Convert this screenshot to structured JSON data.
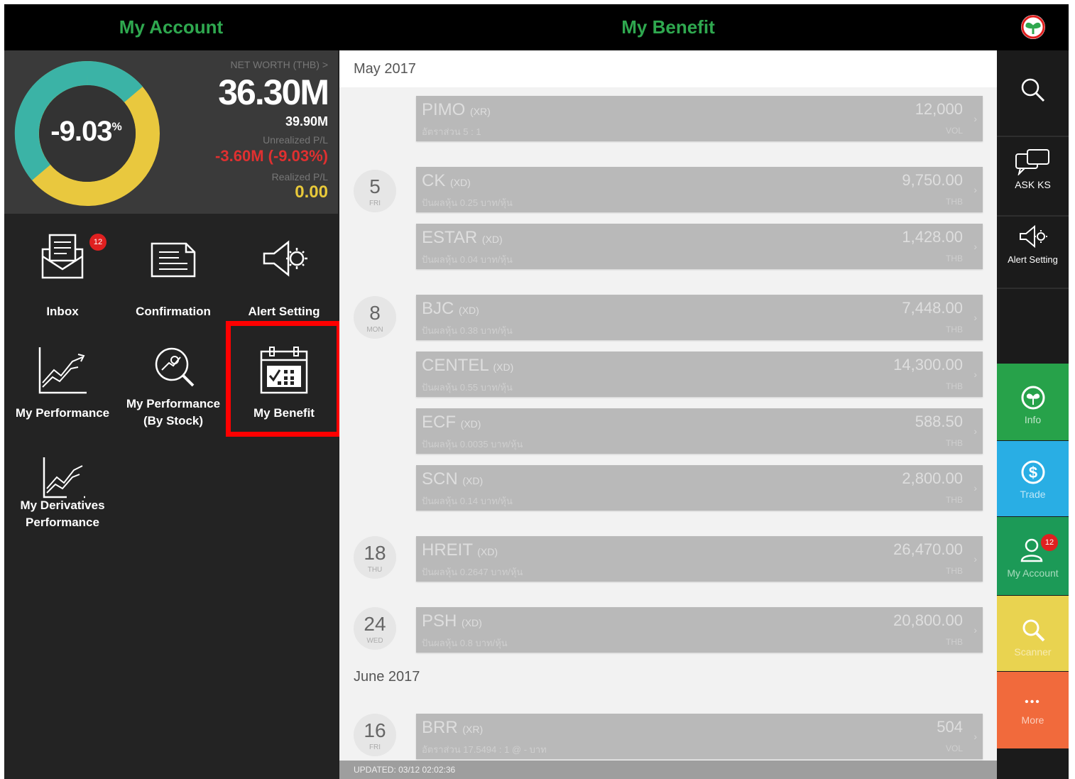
{
  "header": {
    "left_title": "My Account",
    "center_title": "My Benefit"
  },
  "summary": {
    "percent": "-9.03",
    "percent_unit": "%",
    "net_worth_label": "NET WORTH (THB) >",
    "net_worth_value": "36.30M",
    "cost_value": "39.90M",
    "unrealized_label": "Unrealized P/L",
    "unrealized_value": "-3.60M (-9.03%)",
    "realized_label": "Realized P/L",
    "realized_value": "0.00",
    "colors": {
      "teal": "#3bb3a6",
      "yellow": "#e9c83e",
      "loss": "#e03030"
    }
  },
  "menu": {
    "inbox": {
      "label": "Inbox",
      "badge": "12"
    },
    "confirmation": {
      "label": "Confirmation"
    },
    "alert_setting": {
      "label": "Alert Setting"
    },
    "my_performance": {
      "label": "My Performance"
    },
    "my_performance_stock": {
      "label1": "My Performance",
      "label2": "(By Stock)"
    },
    "my_benefit": {
      "label": "My Benefit"
    },
    "my_derivatives": {
      "label1": "My Derivatives",
      "label2": "Performance"
    }
  },
  "benefits": {
    "months": [
      {
        "label": "May 2017"
      },
      {
        "label": "June 2017"
      }
    ],
    "days": [
      {
        "num": "5",
        "wd": "FRI"
      },
      {
        "num": "8",
        "wd": "MON"
      },
      {
        "num": "18",
        "wd": "THU"
      },
      {
        "num": "24",
        "wd": "WED"
      },
      {
        "num": "16",
        "wd": "FRI"
      }
    ],
    "items": [
      {
        "symbol": "PIMO",
        "tag": "XR",
        "detail": "อัตราส่วน 5 : 1",
        "amount": "12,000",
        "unit": "VOL"
      },
      {
        "symbol": "CK",
        "tag": "XD",
        "detail": "ปันผลหุ้น 0.25 บาท/หุ้น",
        "amount": "9,750.00",
        "unit": "THB"
      },
      {
        "symbol": "ESTAR",
        "tag": "XD",
        "detail": "ปันผลหุ้น 0.04 บาท/หุ้น",
        "amount": "1,428.00",
        "unit": "THB"
      },
      {
        "symbol": "BJC",
        "tag": "XD",
        "detail": "ปันผลหุ้น 0.38 บาท/หุ้น",
        "amount": "7,448.00",
        "unit": "THB"
      },
      {
        "symbol": "CENTEL",
        "tag": "XD",
        "detail": "ปันผลหุ้น 0.55 บาท/หุ้น",
        "amount": "14,300.00",
        "unit": "THB"
      },
      {
        "symbol": "ECF",
        "tag": "XD",
        "detail": "ปันผลหุ้น 0.0035 บาท/หุ้น",
        "amount": "588.50",
        "unit": "THB"
      },
      {
        "symbol": "SCN",
        "tag": "XD",
        "detail": "ปันผลหุ้น 0.14 บาท/หุ้น",
        "amount": "2,800.00",
        "unit": "THB"
      },
      {
        "symbol": "HREIT",
        "tag": "XD",
        "detail": "ปันผลหุ้น 0.2647 บาท/หุ้น",
        "amount": "26,470.00",
        "unit": "THB"
      },
      {
        "symbol": "PSH",
        "tag": "XD",
        "detail": "ปันผลหุ้น 0.8 บาท/หุ้น",
        "amount": "20,800.00",
        "unit": "THB"
      },
      {
        "symbol": "BRR",
        "tag": "XR",
        "detail": "อัตราส่วน 17.5494 : 1 @ - บาท",
        "amount": "504",
        "unit": "VOL"
      }
    ],
    "updated": "UPDATED: 03/12 02:02:36"
  },
  "sidebar": {
    "ask": "ASK KS",
    "alert": "Alert Setting",
    "info": "Info",
    "trade": "Trade",
    "account": "My Account",
    "account_badge": "12",
    "scanner": "Scanner",
    "more": "More",
    "colors": {
      "info": "#27a24a",
      "trade": "#29aee4",
      "account": "#1c9a57",
      "scanner": "#e9d350",
      "more": "#f16a3c"
    }
  }
}
